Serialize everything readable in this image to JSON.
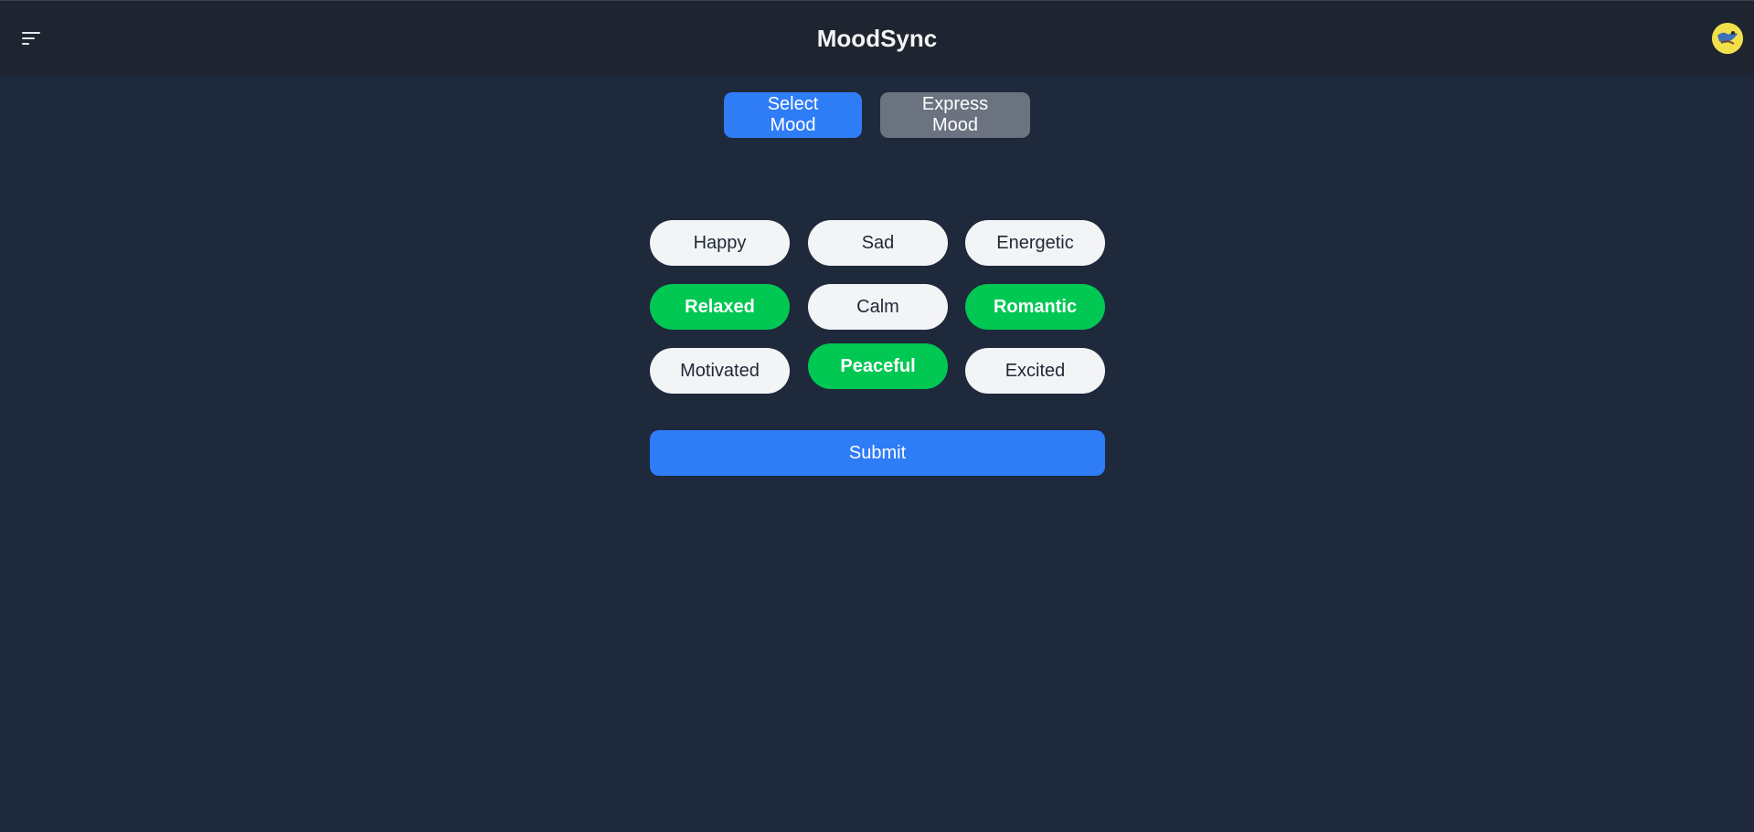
{
  "app": {
    "title": "MoodSync"
  },
  "header": {
    "menu_icon": "menu-icon",
    "avatar_icon": "avatar-icon"
  },
  "mode_toggle": {
    "select_label": "Select Mood",
    "express_label": "Express Mood",
    "active": "select"
  },
  "moods": [
    {
      "label": "Happy",
      "selected": false
    },
    {
      "label": "Sad",
      "selected": false
    },
    {
      "label": "Energetic",
      "selected": false
    },
    {
      "label": "Relaxed",
      "selected": true
    },
    {
      "label": "Calm",
      "selected": false
    },
    {
      "label": "Romantic",
      "selected": true
    },
    {
      "label": "Motivated",
      "selected": false
    },
    {
      "label": "Peaceful",
      "selected": true
    },
    {
      "label": "Excited",
      "selected": false
    }
  ],
  "submit_label": "Submit",
  "colors": {
    "background": "#1e293b",
    "topbar": "#1f2530",
    "primary": "#2e7cf6",
    "inactive": "#6b7280",
    "chip": "#f3f4f6",
    "selected": "#00c853"
  }
}
